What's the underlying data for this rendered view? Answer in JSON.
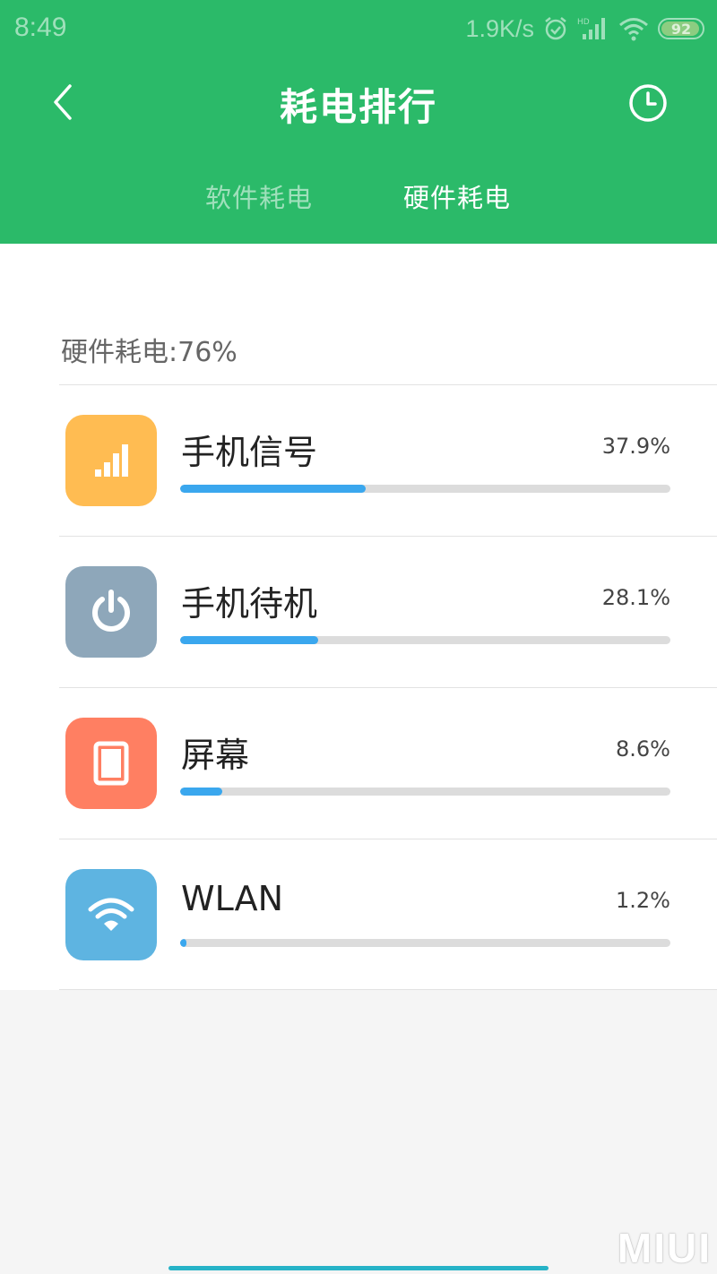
{
  "status_bar": {
    "time": "8:49",
    "net_speed": "1.9K/s",
    "battery": "92"
  },
  "header": {
    "title": "耗电排行",
    "tabs": [
      {
        "label": "软件耗电",
        "active": false
      },
      {
        "label": "硬件耗电",
        "active": true
      }
    ]
  },
  "summary": "硬件耗电:76%",
  "items": [
    {
      "label": "手机信号",
      "value": "37.9%",
      "fraction": 0.379,
      "icon": "cellular-signal-icon",
      "color": "#ffbc52"
    },
    {
      "label": "手机待机",
      "value": "28.1%",
      "fraction": 0.281,
      "icon": "power-icon",
      "color": "#8ea7ba"
    },
    {
      "label": "屏幕",
      "value": "8.6%",
      "fraction": 0.086,
      "icon": "screen-icon",
      "color": "#ff7f62"
    },
    {
      "label": "WLAN",
      "value": "1.2%",
      "fraction": 0.012,
      "icon": "wifi-icon",
      "color": "#5eb4e1"
    }
  ],
  "colors": {
    "header": "#2bba69",
    "bar_fill": "#3aa7ee",
    "bar_track": "#dcdcdc"
  }
}
